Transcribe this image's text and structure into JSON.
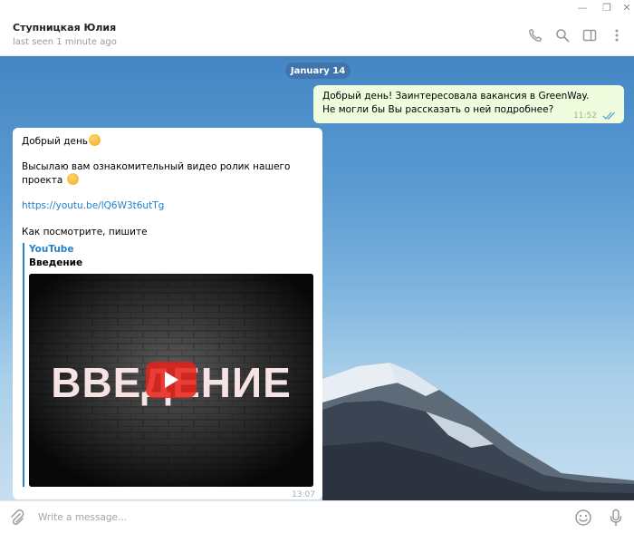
{
  "window": {
    "minimize_glyph": "—",
    "maximize_glyph": "❐",
    "close_glyph": "✕"
  },
  "header": {
    "name": "Ступницкая Юлия",
    "status": "last seen 1 minute ago",
    "icons": [
      "phone-icon",
      "search-icon",
      "sidebar-toggle-icon",
      "more-vertical-icon"
    ]
  },
  "chat": {
    "date_label": "January 14",
    "outgoing": {
      "text": "Добрый день! Заинтересовала вакансия в GreenWay. Не могли бы Вы рассказать о ней подробнее?",
      "time": "11:52",
      "status_icon": "double-check-icon"
    },
    "incoming": {
      "line1": "Добрый день",
      "line2": "Высылаю вам ознакомительный видео ролик нашего проекта",
      "link": "https://youtu.be/lQ6W3t6utTg",
      "line3": "Как посмотрите, пишите",
      "preview": {
        "site": "YouTube",
        "title": "Введение",
        "video_text": "ВВЕДЕНИЕ"
      },
      "time": "13:07"
    }
  },
  "composer": {
    "placeholder": "Write a message...",
    "value": ""
  },
  "colors": {
    "accent": "#2481cc",
    "outgoing_bubble": "#effdde",
    "play_button": "#e62117"
  }
}
